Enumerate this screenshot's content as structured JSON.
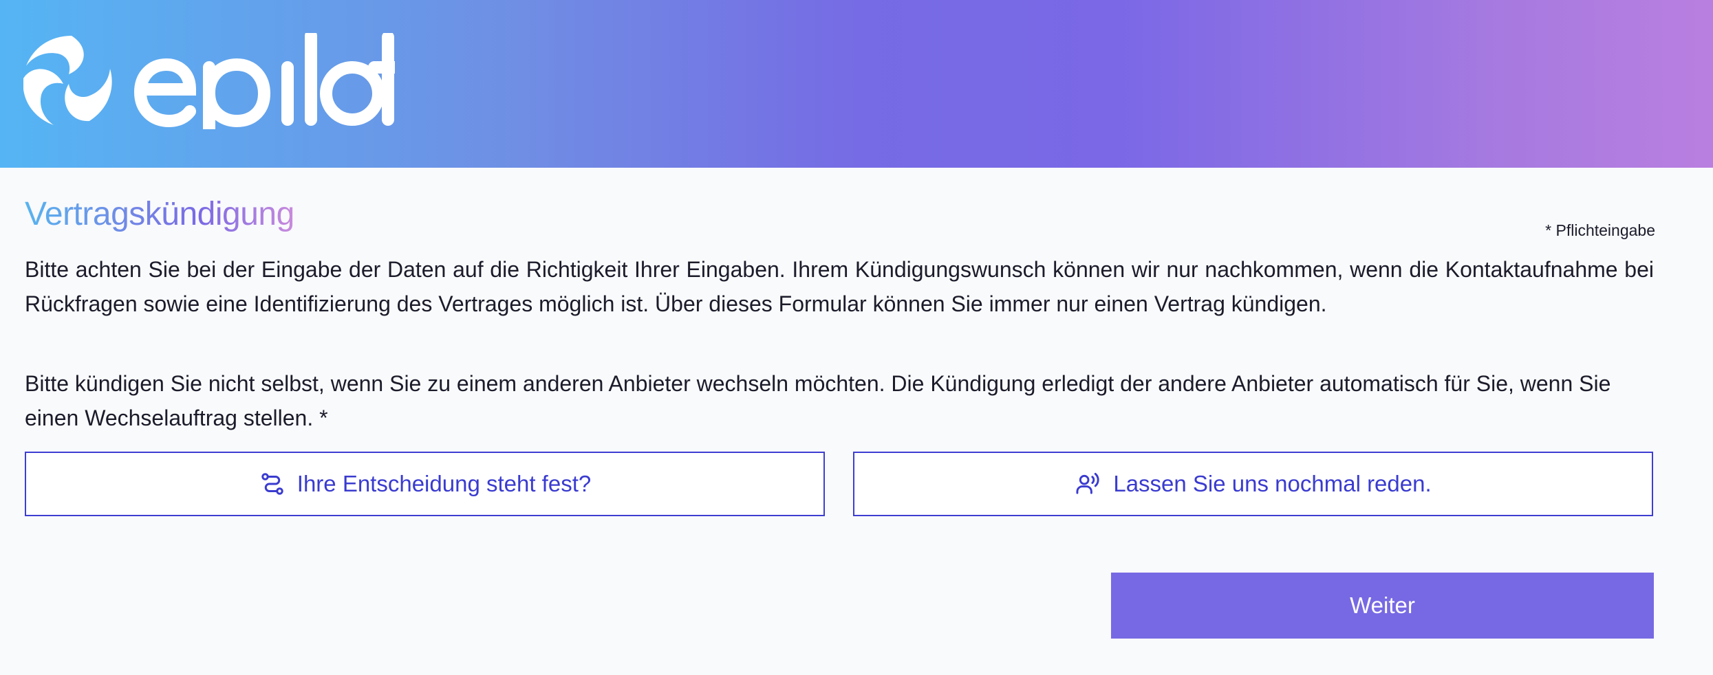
{
  "header": {
    "brand": "epilot",
    "logo_icon": "epilot-swirl-icon",
    "gradient_colors": [
      "#55b5f4",
      "#766be4",
      "#b97fe0"
    ]
  },
  "form": {
    "title": "Vertragskündigung",
    "required_note": "* Pflichteingabe",
    "intro_text": "Bitte achten Sie bei der Eingabe der Daten auf die Richtigkeit Ihrer Eingaben. Ihrem Kündigungswunsch können wir nur nachkommen, wenn die Kontaktaufnahme bei Rückfragen sowie eine Identifizierung des Vertrages möglich ist. Über dieses Formular können Sie immer nur einen Vertrag kündigen.",
    "question_text": "Bitte kündigen Sie nicht selbst, wenn Sie zu einem anderen Anbieter wechseln möchten. Die Kündigung erledigt der andere Anbieter automatisch für Sie, wenn Sie einen Wechselauftrag stellen. *",
    "options": [
      {
        "label": "Ihre Entscheidung steht fest?",
        "icon": "route-icon"
      },
      {
        "label": "Lassen Sie uns nochmal reden.",
        "icon": "user-speaking-icon"
      }
    ],
    "next_label": "Weiter",
    "accent_color": "#3d3ed2",
    "button_color": "#7769e3"
  }
}
